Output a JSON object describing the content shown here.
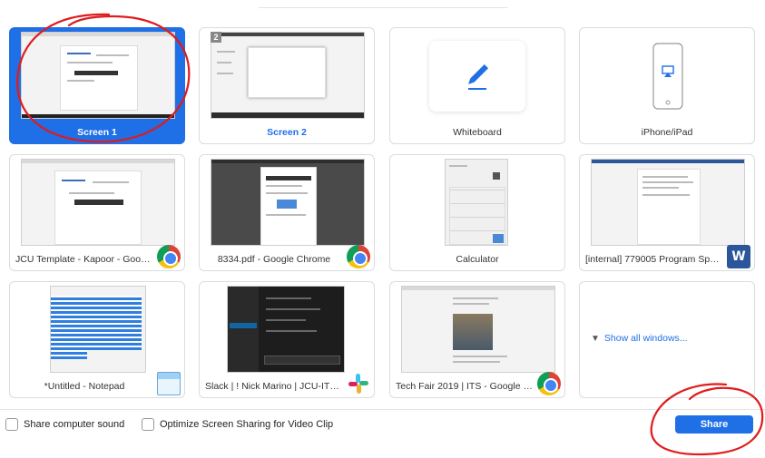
{
  "tiles": [
    {
      "label": "Screen 1",
      "selected": true
    },
    {
      "label": "Screen 2",
      "badge": "2"
    },
    {
      "label": "Whiteboard",
      "icon": "pencil-icon"
    },
    {
      "label": "iPhone/iPad",
      "icon": "iphone-airplay-icon"
    },
    {
      "label": "JCU Template - Kapoor - Google ...",
      "app_icon": "chrome-icon"
    },
    {
      "label": "8334.pdf - Google Chrome",
      "app_icon": "chrome-icon"
    },
    {
      "label": "Calculator"
    },
    {
      "label": "[internal] 779005 Program Spons...",
      "app_icon": "word-icon",
      "app_icon_text": "W"
    },
    {
      "label": "*Untitled - Notepad",
      "app_icon": "notepad-icon"
    },
    {
      "label": "Slack | ! Nick Marino | JCU-ITS | 2...",
      "app_icon": "slack-icon"
    },
    {
      "label": "Tech Fair 2019 | ITS - Google Chro...",
      "app_icon": "chrome-icon"
    }
  ],
  "show_all": {
    "label": "Show all windows...",
    "icon": "windows-stack-icon"
  },
  "options": {
    "share_sound": "Share computer sound",
    "optimize_video": "Optimize Screen Sharing for Video Clip"
  },
  "share_button": {
    "label": "Share"
  },
  "colors": {
    "accent": "#1f6fe6",
    "annotation": "#e01b1b"
  }
}
